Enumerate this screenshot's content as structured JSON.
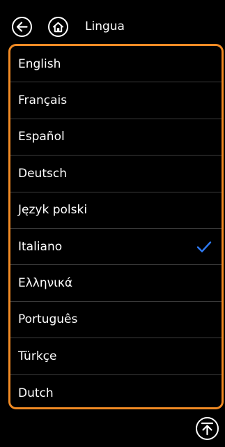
{
  "header": {
    "back_icon": "arrow-left-icon",
    "home_icon": "home-icon",
    "title": "Lingua"
  },
  "languages": [
    {
      "label": "English",
      "selected": false
    },
    {
      "label": "Français",
      "selected": false
    },
    {
      "label": "Español",
      "selected": false
    },
    {
      "label": "Deutsch",
      "selected": false
    },
    {
      "label": "Język polski",
      "selected": false
    },
    {
      "label": "Italiano",
      "selected": true
    },
    {
      "label": "Ελληνικά",
      "selected": false
    },
    {
      "label": "Português",
      "selected": false
    },
    {
      "label": "Türkçe",
      "selected": false
    },
    {
      "label": "Dutch",
      "selected": false
    }
  ],
  "scroll_top_icon": "arrow-up-to-top-icon",
  "colors": {
    "accent_border": "#f08a24",
    "check": "#2f7bf5",
    "background": "#000000",
    "text": "#ffffff"
  }
}
